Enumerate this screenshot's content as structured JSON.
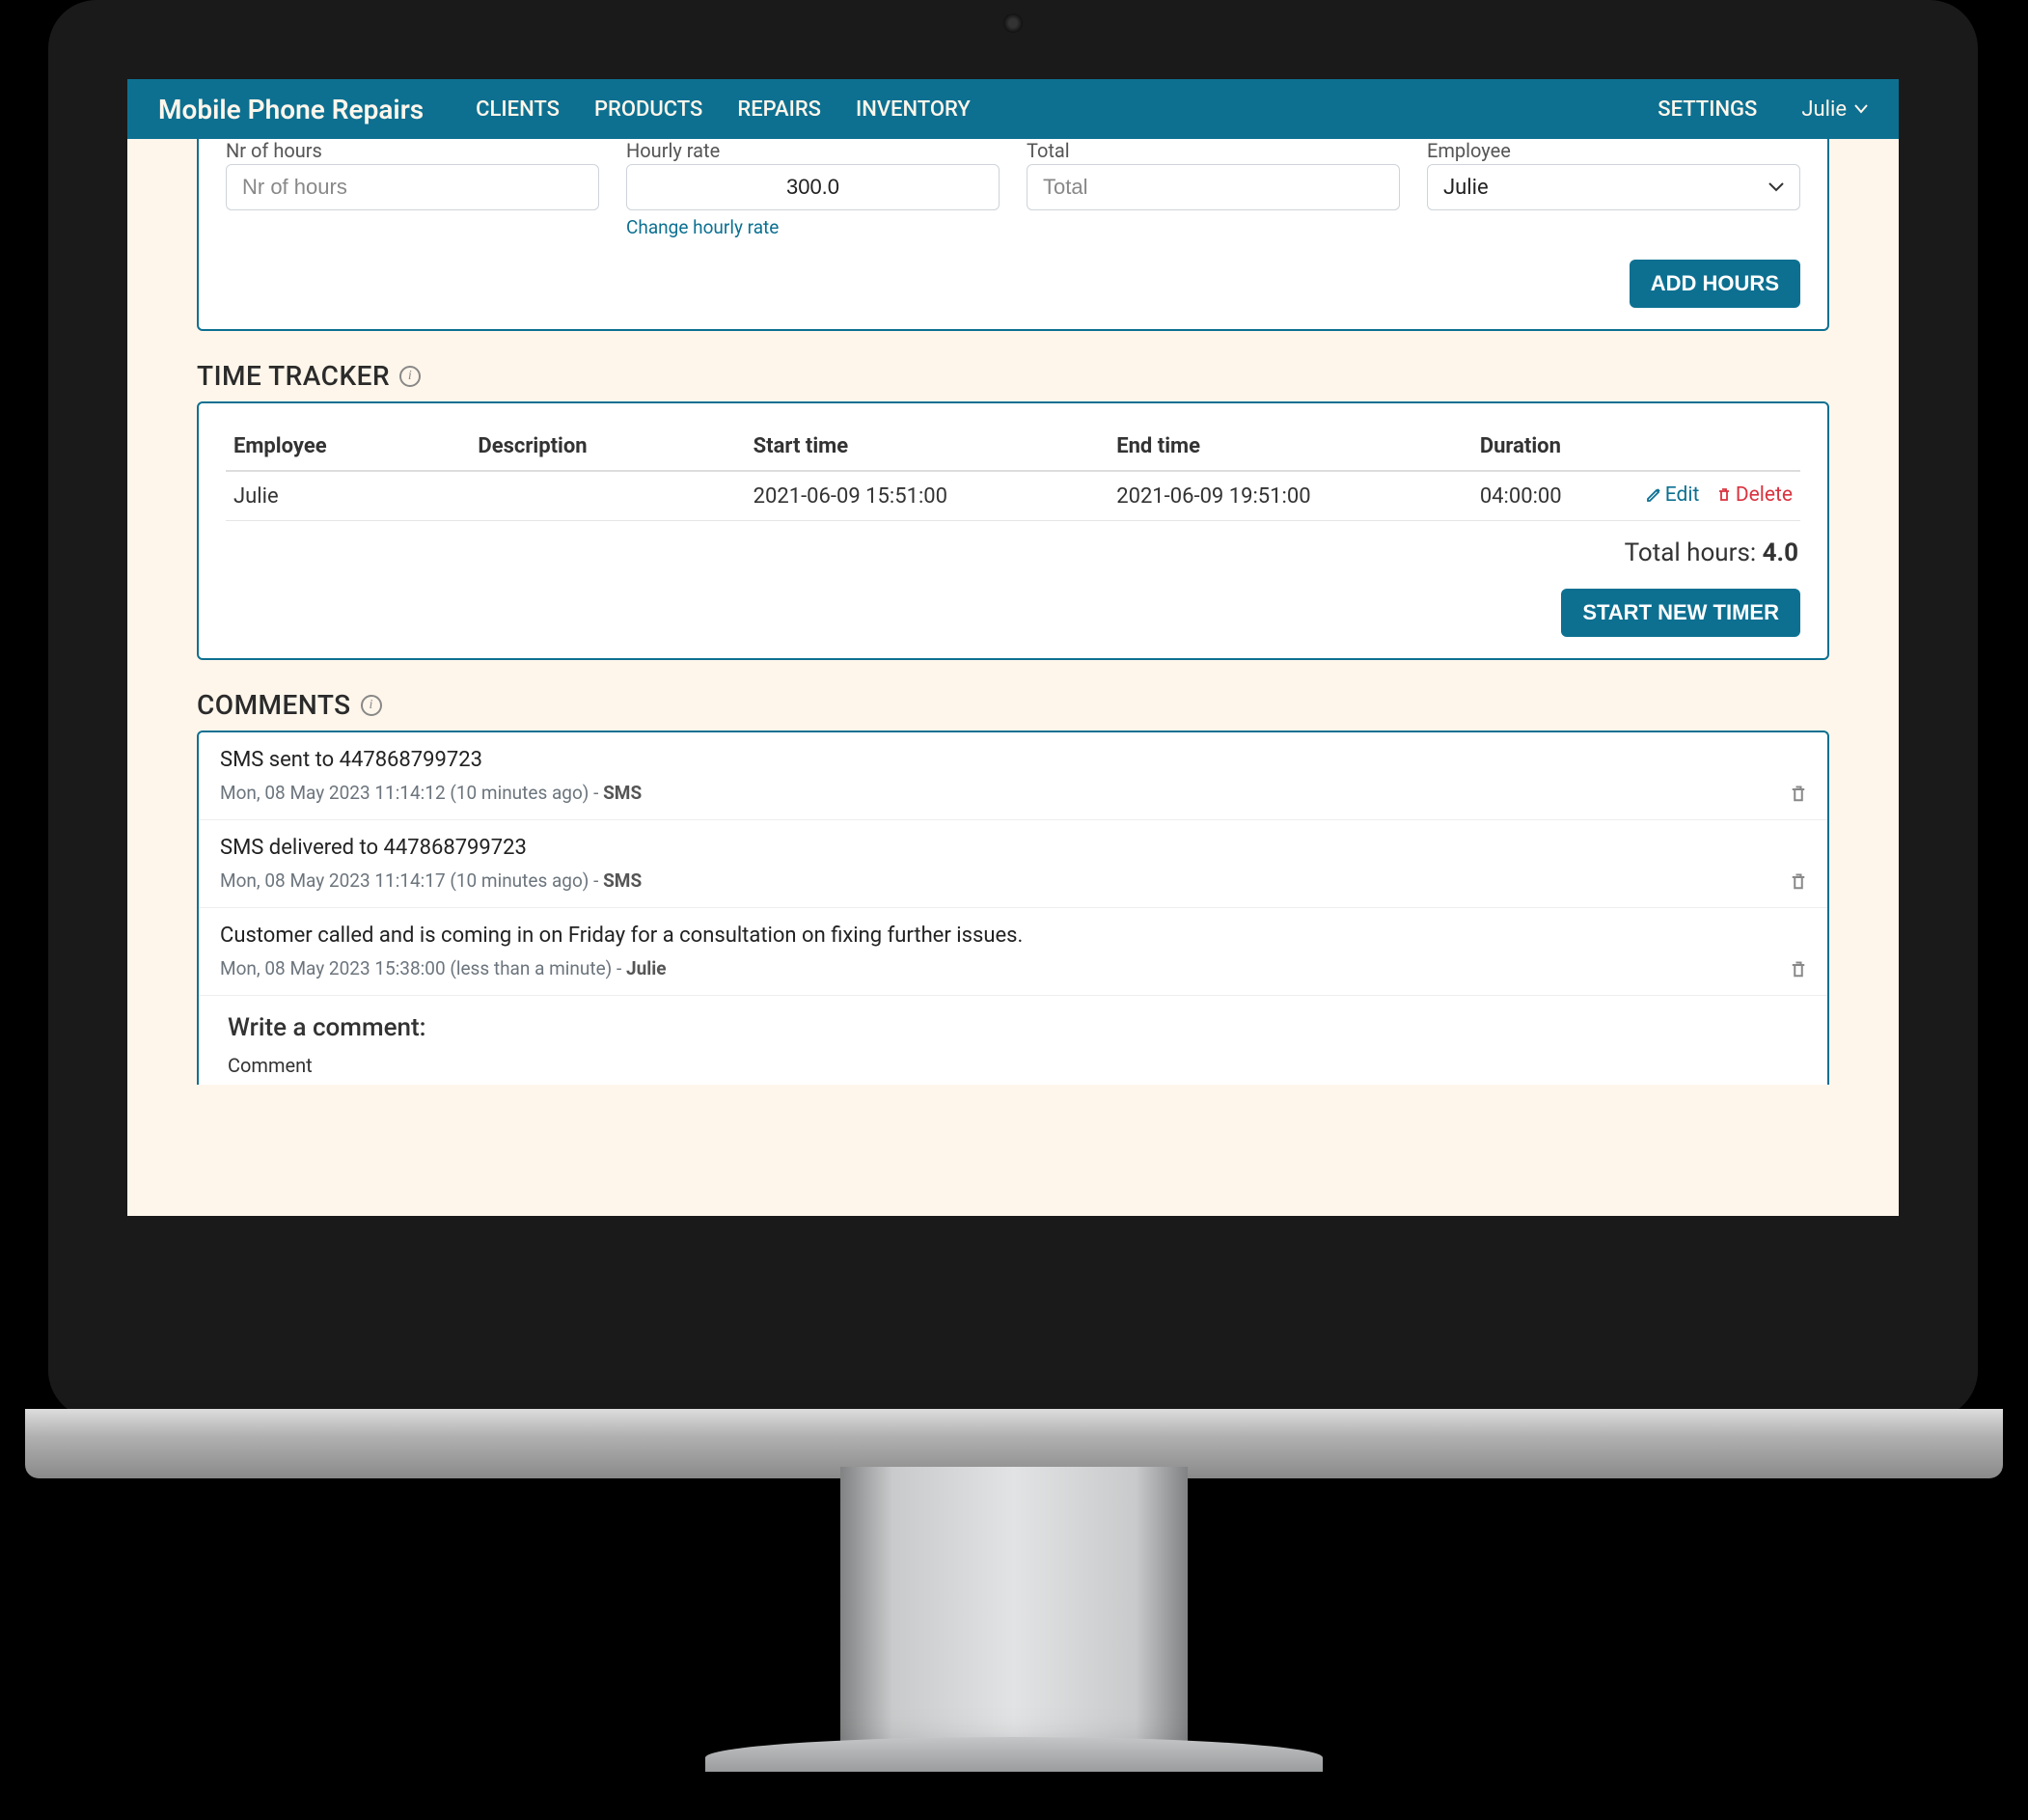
{
  "nav": {
    "brand": "Mobile Phone Repairs",
    "items": [
      "CLIENTS",
      "PRODUCTS",
      "REPAIRS",
      "INVENTORY"
    ],
    "settings": "SETTINGS",
    "user": "Julie"
  },
  "hours_form": {
    "fields": {
      "nr_hours_label": "Nr of hours",
      "nr_hours_placeholder": "Nr of hours",
      "rate_label": "Hourly rate",
      "rate_value": "300.0",
      "change_rate_link": "Change hourly rate",
      "total_label": "Total",
      "total_placeholder": "Total",
      "employee_label": "Employee",
      "employee_value": "Julie"
    },
    "add_button": "ADD HOURS"
  },
  "tracker": {
    "title": "TIME TRACKER",
    "headers": {
      "employee": "Employee",
      "description": "Description",
      "start": "Start time",
      "end": "End time",
      "duration": "Duration"
    },
    "rows": [
      {
        "employee": "Julie",
        "description": "",
        "start": "2021-06-09 15:51:00",
        "end": "2021-06-09 19:51:00",
        "duration": "04:00:00"
      }
    ],
    "edit_label": "Edit",
    "delete_label": "Delete",
    "total_label": "Total hours:",
    "total_value": "4.0",
    "start_button": "START NEW TIMER"
  },
  "comments": {
    "title": "COMMENTS",
    "items": [
      {
        "body": "SMS sent to 447868799723",
        "meta_time": "Mon, 08 May 2023 11:14:12 (10 minutes ago)",
        "sep": " - ",
        "author": "SMS"
      },
      {
        "body": "SMS delivered to 447868799723",
        "meta_time": "Mon, 08 May 2023 11:14:17 (10 minutes ago)",
        "sep": " - ",
        "author": "SMS"
      },
      {
        "body": "Customer called and is coming in on Friday for a consultation on fixing further issues.",
        "meta_time": "Mon, 08 May 2023 15:38:00 (less than a minute)",
        "sep": " - ",
        "author": "Julie"
      }
    ],
    "write_heading": "Write a comment:",
    "comment_label": "Comment"
  }
}
